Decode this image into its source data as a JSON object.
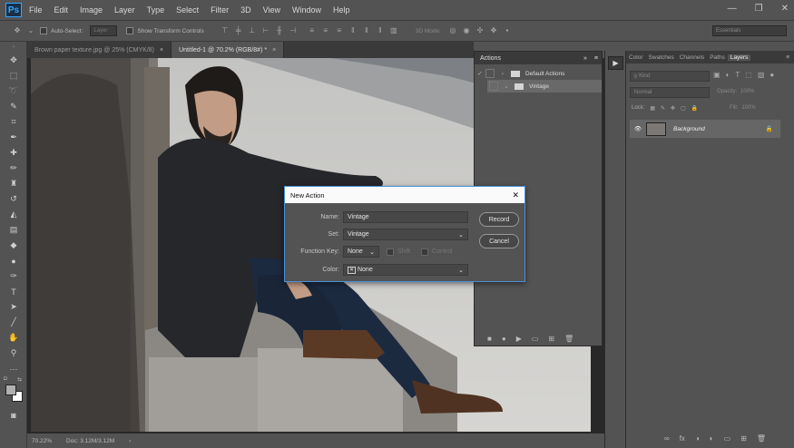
{
  "app": {
    "logo": "Ps"
  },
  "menu": [
    "File",
    "Edit",
    "Image",
    "Layer",
    "Type",
    "Select",
    "Filter",
    "3D",
    "View",
    "Window",
    "Help"
  ],
  "window_controls": [
    "—",
    "❐",
    "✕"
  ],
  "options": {
    "auto_select_label": "Auto-Select:",
    "auto_select_value": "Layer",
    "transform_label": "Show Transform Controls",
    "mode_3d_label": "3D Mode:",
    "workspace": "Essentials"
  },
  "tabs": [
    {
      "label": "Brown paper texture.jpg @ 25% (CMYK/8)",
      "close": "×"
    },
    {
      "label": "Untitled-1 @ 70.2% (RGB/8#) *",
      "close": "×"
    }
  ],
  "status": {
    "zoom": "70.22%",
    "doc": "Doc: 3.12M/3.12M",
    "arrow": "›"
  },
  "actions": {
    "title": "Actions",
    "head_icons": {
      "collapse": "»",
      "menu": "≡"
    },
    "rows": [
      {
        "check": "✓",
        "twirl": "›",
        "label": "Default Actions"
      },
      {
        "check": "",
        "twirl": "⌄",
        "label": "Vintage"
      }
    ],
    "bottom": [
      "■",
      "●",
      "▶",
      "▭",
      "⊞",
      "🗑"
    ]
  },
  "layers": {
    "tabs": [
      "Color",
      "Swatches",
      "Channels",
      "Paths",
      "Layers"
    ],
    "active_tab": "Layers",
    "kind": "Kind",
    "blend": "Normal",
    "opacity_label": "Opacity:",
    "opacity": "100%",
    "lock_label": "Lock:",
    "fill_label": "Fill:",
    "fill": "100%",
    "layer_name": "Background",
    "bottom": [
      "∞",
      "fx",
      "◑",
      "◐",
      "▭",
      "⊞",
      "🗑"
    ]
  },
  "dialog": {
    "title": "New Action",
    "close": "✕",
    "name_label": "Name:",
    "name_value": "Vintage",
    "set_label": "Set:",
    "set_value": "Vintage",
    "fkey_label": "Function Key:",
    "fkey_value": "None",
    "shift_label": "Shift",
    "control_label": "Control",
    "color_label": "Color:",
    "color_value": "None",
    "record": "Record",
    "cancel": "Cancel"
  }
}
